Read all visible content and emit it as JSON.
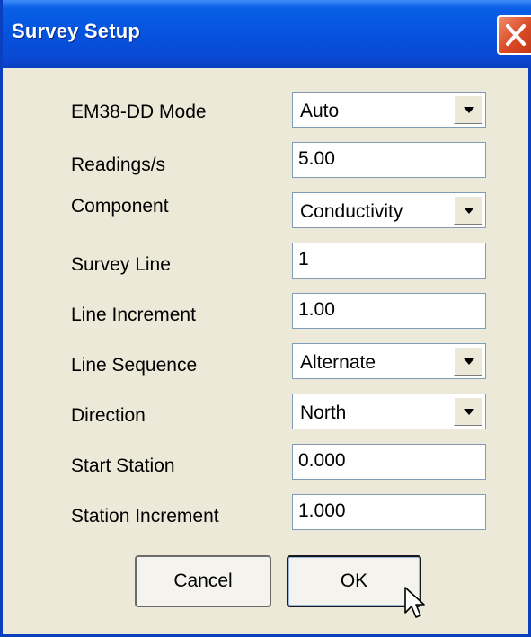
{
  "window": {
    "title": "Survey Setup"
  },
  "fields": [
    {
      "label": "EM38-DD Mode",
      "value": "Auto",
      "type": "select"
    },
    {
      "label": "Readings/s",
      "value": "5.00",
      "type": "text"
    },
    {
      "label": "Component",
      "value": "Conductivity",
      "type": "select"
    },
    {
      "label": "Survey Line",
      "value": "1",
      "type": "text"
    },
    {
      "label": "Line Increment",
      "value": "1.00",
      "type": "text"
    },
    {
      "label": "Line Sequence",
      "value": "Alternate",
      "type": "select"
    },
    {
      "label": "Direction",
      "value": "North",
      "type": "select"
    },
    {
      "label": "Start Station",
      "value": "0.000",
      "type": "text"
    },
    {
      "label": "Station Increment",
      "value": "1.000",
      "type": "text"
    }
  ],
  "buttons": {
    "cancel": "Cancel",
    "ok": "OK"
  },
  "colors": {
    "titlebar": "#0553de",
    "dialog_bg": "#ece9d8",
    "close": "#d94a24"
  },
  "icons": {
    "close": "close-x-icon",
    "dropdown": "chevron-down-icon",
    "cursor": "mouse-pointer-icon"
  }
}
